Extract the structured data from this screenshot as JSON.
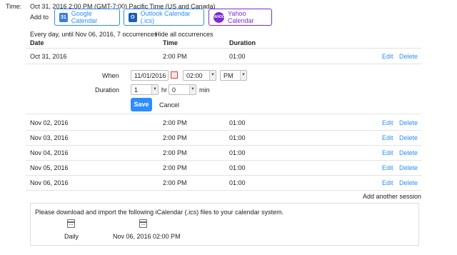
{
  "time": {
    "label": "Time:",
    "value": "Oct 31, 2016 2:00 PM (GMT-7:00) Pacific Time (US and Canada)"
  },
  "add_to": {
    "label": "Add to",
    "google": "Google Calendar",
    "outlook": "Outlook Calendar (.ics)",
    "yahoo": "Yahoo Calendar",
    "google_icon_text": "31",
    "outlook_icon_text": "O",
    "yahoo_icon_text": "YAHOO!"
  },
  "recurrence": {
    "summary": "Every day, until Nov 06, 2016, 7 occurrences",
    "hide_link": "Hide all occurrences"
  },
  "table": {
    "headers": {
      "date": "Date",
      "time": "Time",
      "duration": "Duration"
    },
    "edit_label": "Edit",
    "delete_label": "Delete",
    "rows": [
      {
        "date": "Oct 31, 2016",
        "time": "2:00 PM",
        "duration": "01:00"
      },
      {
        "date": "Nov 02, 2016",
        "time": "2:00 PM",
        "duration": "01:00"
      },
      {
        "date": "Nov 03, 2016",
        "time": "2:00 PM",
        "duration": "01:00"
      },
      {
        "date": "Nov 04, 2016",
        "time": "2:00 PM",
        "duration": "01:00"
      },
      {
        "date": "Nov 05, 2016",
        "time": "2:00 PM",
        "duration": "01:00"
      },
      {
        "date": "Nov 06, 2016",
        "time": "2:00 PM",
        "duration": "01:00"
      }
    ]
  },
  "editor": {
    "when_label": "When",
    "date_value": "11/01/2016",
    "hour_value": "02:00",
    "ampm_value": "PM",
    "duration_label": "Duration",
    "duration_hr_value": "1",
    "hr_label": "hr",
    "duration_min_value": "0",
    "min_label": "min",
    "save_label": "Save",
    "cancel_label": "Cancel"
  },
  "add_session": "Add another session",
  "download": {
    "message": "Please download and import the following iCalendar (.ics) files to your calendar system.",
    "files": [
      "Daily",
      "Nov 06, 2016 02:00 PM"
    ]
  },
  "colors": {
    "accent": "#2d8cff",
    "yahoo": "#7b2cd1",
    "save_button": "#2d8cff"
  }
}
